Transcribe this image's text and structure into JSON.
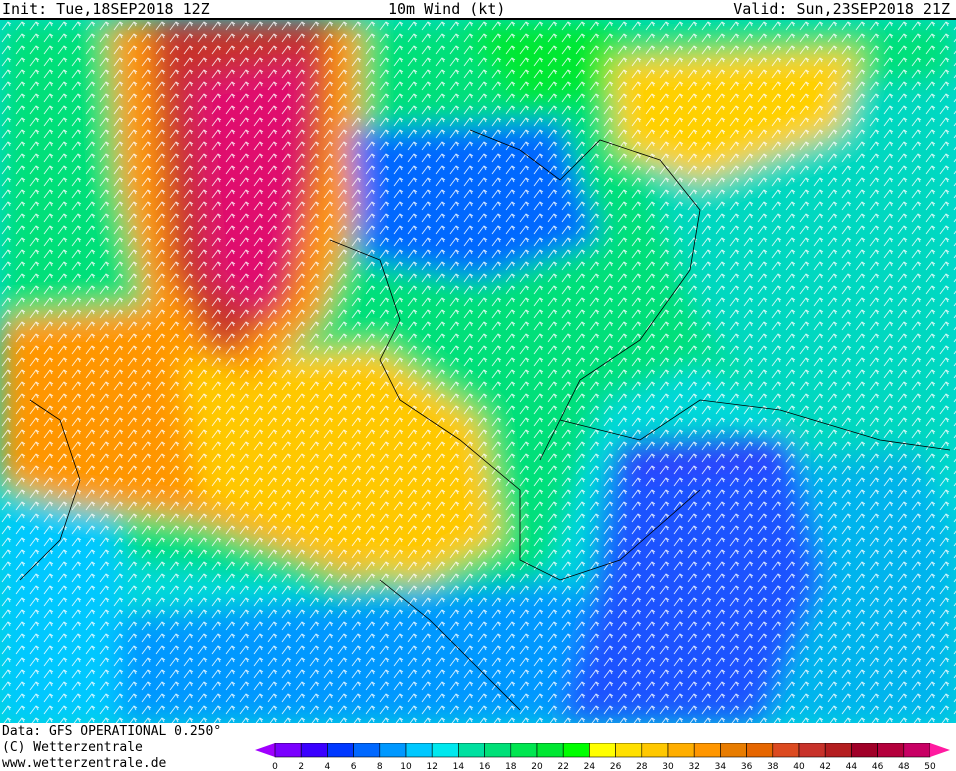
{
  "header": {
    "init": "Init: Tue,18SEP2018 12Z",
    "title": "10m Wind (kt)",
    "valid": "Valid: Sun,23SEP2018 21Z"
  },
  "footer": {
    "data_source": "Data: GFS OPERATIONAL 0.250°",
    "copyright": "(C) Wetterzentrale",
    "website": "www.wetterzentrale.de"
  },
  "legend": {
    "unit": "kt",
    "ticks": [
      "0",
      "2",
      "4",
      "6",
      "8",
      "10",
      "12",
      "14",
      "16",
      "18",
      "20",
      "22",
      "24",
      "26",
      "28",
      "30",
      "32",
      "34",
      "36",
      "38",
      "40",
      "42",
      "44",
      "46",
      "48",
      "50"
    ],
    "below_color": "#a000ff",
    "above_color": "#ff1aa0",
    "colors": [
      "#7a00ff",
      "#3a00ff",
      "#0038ff",
      "#0068ff",
      "#0098ff",
      "#00c8ff",
      "#00e8ee",
      "#00e0a0",
      "#00e078",
      "#00e650",
      "#00e832",
      "#00ff00",
      "#ffff00",
      "#ffe000",
      "#ffc800",
      "#ffae00",
      "#ff9600",
      "#e87c00",
      "#e66600",
      "#dc4a20",
      "#c8322a",
      "#b41e20",
      "#a00028",
      "#b4003c",
      "#c80064"
    ]
  }
}
